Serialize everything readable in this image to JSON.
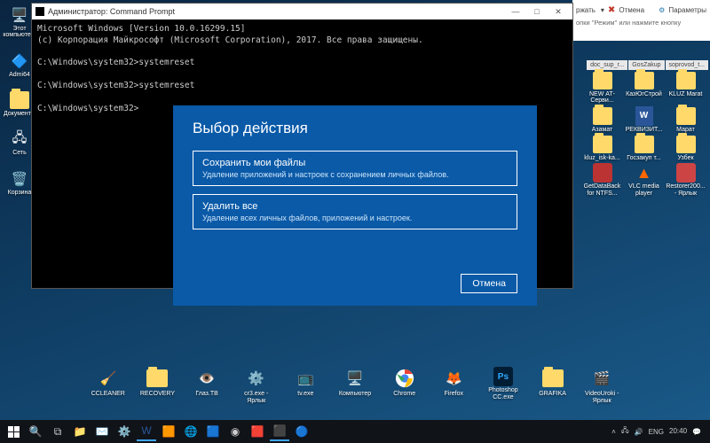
{
  "desktop_left": [
    {
      "label": "Этот компьюте...",
      "name": "this-pc-icon"
    },
    {
      "label": "Admi64",
      "name": "admin64-icon"
    },
    {
      "label": "Документы",
      "name": "documents-icon"
    },
    {
      "label": "Сеть",
      "name": "network-icon"
    },
    {
      "label": "Корзина",
      "name": "recycle-bin-icon"
    }
  ],
  "desktop_right": [
    {
      "label": "NEW АТ-Серви..."
    },
    {
      "label": "КазЮгСтрой"
    },
    {
      "label": "KLUZ Marat"
    },
    {
      "label": "Азамат"
    },
    {
      "label": "РЕКВИЗИТ..."
    },
    {
      "label": "Марат"
    },
    {
      "label": "kluz_isk-ka..."
    },
    {
      "label": "Госзакуп т..."
    },
    {
      "label": "Узбек"
    },
    {
      "label": "GetDataBack for NTFS..."
    },
    {
      "label": "VLC media player"
    },
    {
      "label": "Restorer200... - Ярлык"
    }
  ],
  "row_icons": [
    {
      "label": "CCLEANER"
    },
    {
      "label": "RECOVERY"
    },
    {
      "label": "Глаз.ТВ"
    },
    {
      "label": "cr3.exe - Ярлык"
    },
    {
      "label": "tv.exe"
    },
    {
      "label": "Компьютер"
    },
    {
      "label": "Chrome"
    },
    {
      "label": "Firefox"
    },
    {
      "label": "Photoshop CC.exe"
    },
    {
      "label": "GRAFIKA"
    },
    {
      "label": "VideoUroki - Ярлык"
    }
  ],
  "cmd": {
    "title": "Администратор: Command Prompt",
    "line1": "Microsoft Windows [Version 10.0.16299.15]",
    "line2": "(c) Корпорация Майкрософт (Microsoft Corporation), 2017. Все права защищены.",
    "line3": "C:\\Windows\\system32>systemreset",
    "line4": "C:\\Windows\\system32>systemreset",
    "line5": "C:\\Windows\\system32>"
  },
  "dialog": {
    "title": "Выбор действия",
    "opt1_title": "Сохранить мои файлы",
    "opt1_desc": "Удаление приложений и настроек с сохранением личных файлов.",
    "opt2_title": "Удалить все",
    "opt2_desc": "Удаление всех личных файлов, приложений и настроек.",
    "cancel": "Отмена"
  },
  "topstrip": {
    "save": "ржать",
    "cancel": "Отмена",
    "params": "Параметры",
    "hint": "опки \"Режим\" или нажмите кнопку"
  },
  "filetabs": [
    "doc_sup_r...",
    "GosZakup",
    "soprovod_t..."
  ],
  "tray": {
    "lang": "ENG",
    "time": "20:40"
  }
}
